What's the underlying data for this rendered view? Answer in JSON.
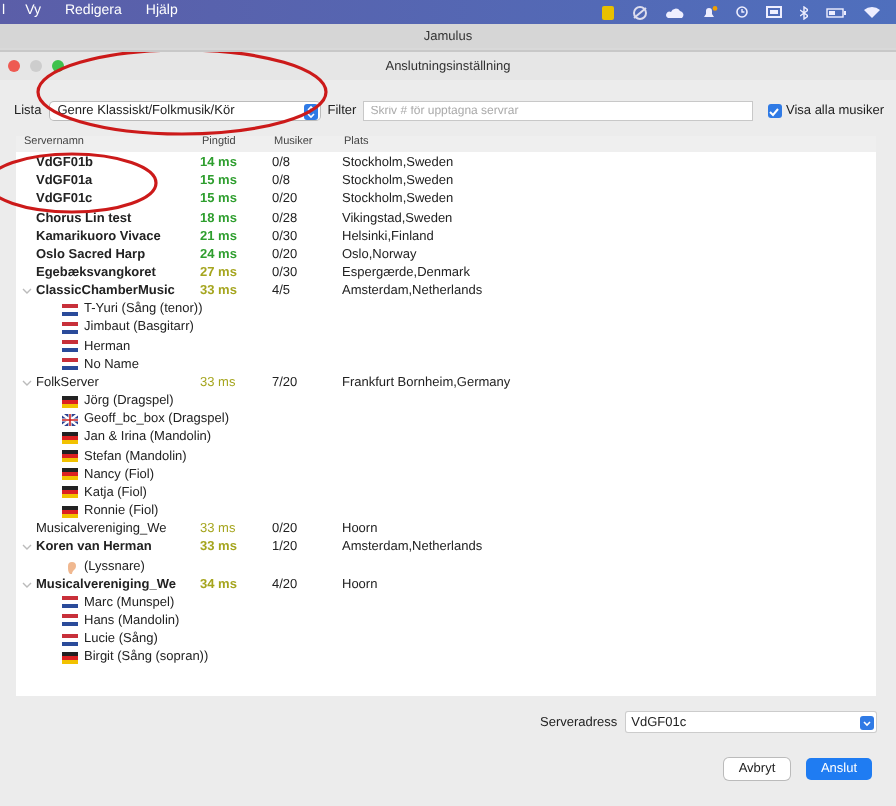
{
  "menu_bar": {
    "items": [
      "l",
      "Vy",
      "Redigera",
      "Hjälp"
    ]
  },
  "app_title": "Jamulus",
  "window": {
    "title": "Anslutningsinställning"
  },
  "toolbar": {
    "list_label": "Lista",
    "list_value": "Genre Klassiskt/Folkmusik/Kör",
    "filter_label": "Filter",
    "filter_placeholder": "Skriv # för upptagna servrar",
    "show_all": {
      "label": "Visa alla musiker",
      "checked": true
    }
  },
  "table": {
    "columns": [
      "Servernamn",
      "Pingtid",
      "Musiker",
      "Plats"
    ],
    "rows": [
      {
        "name": "VdGF01b",
        "ping": "14 ms",
        "color": "#2e9e2e",
        "musicians": "0/8",
        "location": "Stockholm,Sweden",
        "bold": true
      },
      {
        "name": "VdGF01a",
        "ping": "15 ms",
        "color": "#2e9e2e",
        "musicians": "0/8",
        "location": "Stockholm,Sweden",
        "bold": true
      },
      {
        "name": "VdGF01c",
        "ping": "15 ms",
        "color": "#2e9e2e",
        "musicians": "0/20",
        "location": "Stockholm,Sweden",
        "bold": true
      },
      {
        "name": "Chorus Lin test",
        "ping": "18 ms",
        "color": "#2e9e2e",
        "musicians": "0/28",
        "location": "Vikingstad,Sweden",
        "bold": true
      },
      {
        "name": "Kamarikuoro Vivace",
        "ping": "21 ms",
        "color": "#2e9e2e",
        "musicians": "0/30",
        "location": "Helsinki,Finland",
        "bold": true
      },
      {
        "name": "Oslo Sacred Harp",
        "ping": "24 ms",
        "color": "#2e9e2e",
        "musicians": "0/20",
        "location": "Oslo,Norway",
        "bold": true
      },
      {
        "name": "Egebæksvangkoret",
        "ping": "27 ms",
        "color": "#a5a51e",
        "musicians": "0/30",
        "location": "Espergærde,Denmark",
        "bold": true
      },
      {
        "name": "ClassicChamberMusic",
        "ping": "33 ms",
        "color": "#a5a51e",
        "musicians": "4/5",
        "location": "Amsterdam,Netherlands",
        "bold": true,
        "expanded": true,
        "children": [
          {
            "name": "T-Yuri (Sång (tenor))",
            "kind": "nl"
          },
          {
            "name": "Jimbaut (Basgitarr)",
            "kind": "nl"
          },
          {
            "name": "Herman",
            "kind": "nl"
          },
          {
            "name": "No Name",
            "kind": "nl"
          }
        ]
      },
      {
        "name": "FolkServer",
        "ping": "33 ms",
        "color": "#a5a51e",
        "musicians": "7/20",
        "location": "Frankfurt Bornheim,Germany",
        "bold": false,
        "expanded": true,
        "children": [
          {
            "name": "Jörg  (Dragspel)",
            "kind": "de"
          },
          {
            "name": "Geoff_bc_box (Dragspel)",
            "kind": "gb"
          },
          {
            "name": "Jan & Irina (Mandolin)",
            "kind": "de"
          },
          {
            "name": "Stefan (Mandolin)",
            "kind": "de"
          },
          {
            "name": "Nancy (Fiol)",
            "kind": "de"
          },
          {
            "name": "Katja (Fiol)",
            "kind": "de"
          },
          {
            "name": "Ronnie (Fiol)",
            "kind": "de"
          }
        ]
      },
      {
        "name": "Musicalvereniging_We",
        "ping": "33 ms",
        "color": "#a5a51e",
        "musicians": "0/20",
        "location": "Hoorn",
        "bold": false
      },
      {
        "name": "Koren van Herman",
        "ping": "33 ms",
        "color": "#a5a51e",
        "musicians": "1/20",
        "location": "Amsterdam,Netherlands",
        "bold": true,
        "expanded": true,
        "children": [
          {
            "name": "(Lyssnare)",
            "kind": "listener"
          }
        ]
      },
      {
        "name": "Musicalvereniging_We",
        "ping": "34 ms",
        "color": "#a5a51e",
        "musicians": "4/20",
        "location": "Hoorn",
        "bold": true,
        "expanded": true,
        "children": [
          {
            "name": "Marc (Munspel)",
            "kind": "nl"
          },
          {
            "name": "Hans (Mandolin)",
            "kind": "nl"
          },
          {
            "name": "Lucie (Sång)",
            "kind": "nl"
          },
          {
            "name": "Birgit (Sång (sopran))",
            "kind": "de"
          }
        ]
      }
    ]
  },
  "server_address": {
    "label": "Serveradress",
    "value": "VdGF01c"
  },
  "buttons": [
    {
      "label": "Avbryt",
      "kind": "secondary"
    },
    {
      "label": "Anslut",
      "kind": "primary"
    }
  ]
}
